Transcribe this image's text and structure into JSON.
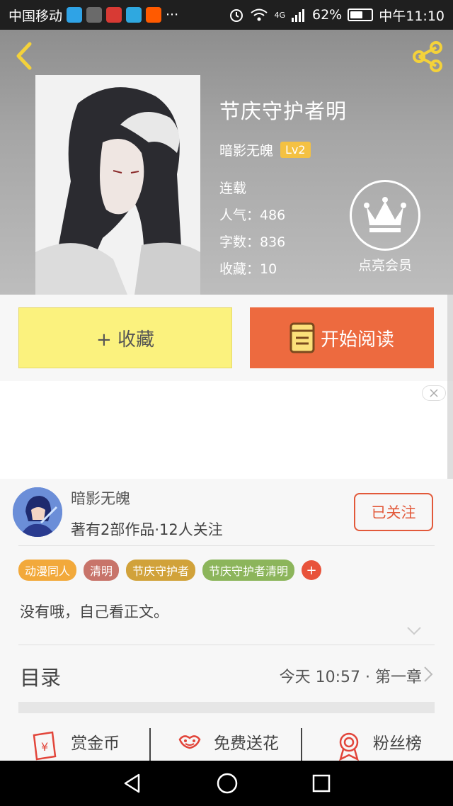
{
  "status_bar": {
    "carrier": "中国移动",
    "more": "···",
    "network": "4G",
    "battery": "62%",
    "battery_level": 0.62,
    "time": "中午11:10",
    "app_icons": [
      "play-icon",
      "cube-icon",
      "toutiao-icon",
      "telegram-icon",
      "taobao-icon"
    ]
  },
  "header": {
    "book_title": "节庆守护者明",
    "author": "暗影无魄",
    "level": "Lv2",
    "status": "连载",
    "popularity": "人气：486",
    "word_count": "字数：836",
    "collections": "收藏：10",
    "vip_label": "点亮会员"
  },
  "actions": {
    "collect_label": "+ 收藏",
    "read_label": "开始阅读"
  },
  "author_card": {
    "name": "暗影无魄",
    "stats": "著有2部作品·12人关注",
    "follow_label": "已关注",
    "tags": [
      {
        "label": "动漫同人",
        "color": "#f2a93b"
      },
      {
        "label": "清明",
        "color": "#c8746a"
      },
      {
        "label": "节庆守护者",
        "color": "#d1a23a"
      },
      {
        "label": "节庆守护者清明",
        "color": "#8cb55b"
      }
    ],
    "tag_add": "+",
    "synopsis": "没有哦，自己看正文。",
    "catalog_title": "目录",
    "catalog_latest": "今天 10:57 · 第一章"
  },
  "bottom_tabs": [
    {
      "label": "赏金币",
      "icon": "red-envelope-icon"
    },
    {
      "label": "免费送花",
      "icon": "flower-icon"
    },
    {
      "label": "粉丝榜",
      "icon": "rank-icon"
    }
  ],
  "colors": {
    "accent_orange": "#ed6a3f",
    "collect_yellow": "#fbf27e",
    "follow_red": "#e2593a",
    "level_badge": "#f4c142"
  }
}
